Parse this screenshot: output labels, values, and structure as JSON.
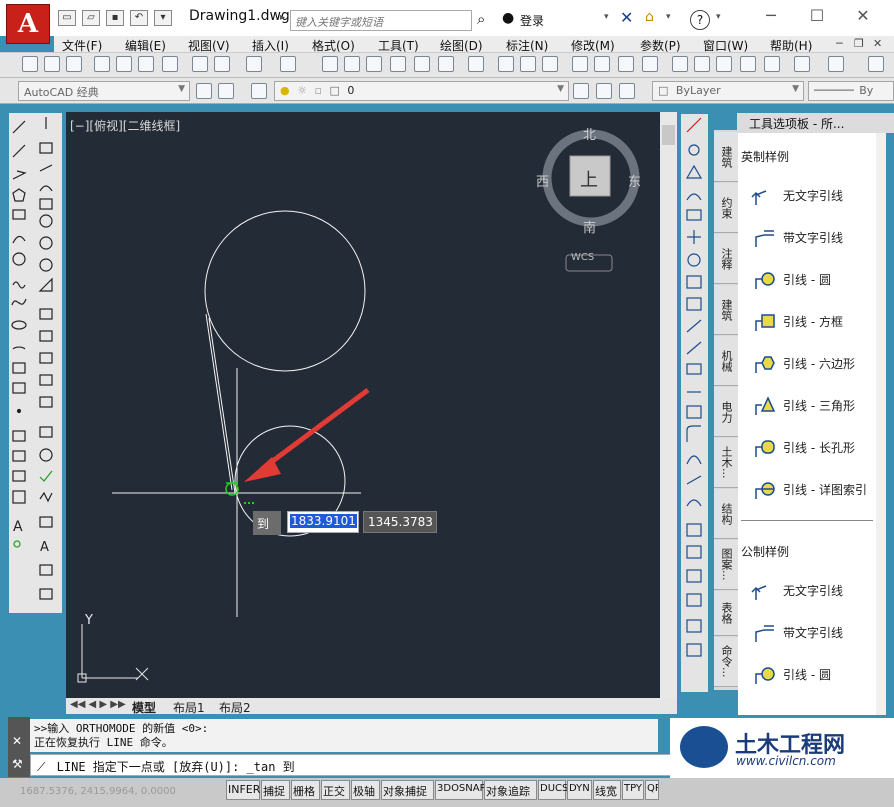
{
  "app": {
    "logo": "A",
    "document_title": "Drawing1.dwg",
    "search_placeholder": "键入关键字或短语",
    "login": "登录"
  },
  "menu": [
    "文件(F)",
    "编辑(E)",
    "视图(V)",
    "插入(I)",
    "格式(O)",
    "工具(T)",
    "绘图(D)",
    "标注(N)",
    "修改(M)",
    "参数(P)",
    "窗口(W)",
    "帮助(H)"
  ],
  "toolbar": {
    "workspace": "AutoCAD 经典",
    "layer": "0",
    "linetype": "ByLayer",
    "linetype_tail": "By"
  },
  "viewport": {
    "label": "[−][俯视][二维线框]",
    "viewcube": {
      "north": "北",
      "south": "南",
      "east": "东",
      "west": "西",
      "top": "上",
      "wcs": "WCS"
    },
    "ucs_y": "Y",
    "ucs_x": "X",
    "dynamic_input": {
      "label": "到",
      "x_value": "1833.9101",
      "y_value": "1345.3783"
    }
  },
  "layout_tabs": [
    "模型",
    "布局1",
    "布局2"
  ],
  "palette": {
    "title": "工具选项板 - 所...",
    "side_tabs": [
      "建筑",
      "约束",
      "注释",
      "建筑",
      "机械",
      "电力",
      "土木...",
      "结构",
      "图案...",
      "表格",
      "命令..."
    ],
    "section_imperial": "英制样例",
    "imperial_items": [
      "无文字引线",
      "带文字引线",
      "引线 - 圆",
      "引线 - 方框",
      "引线 - 六边形",
      "引线 - 三角形",
      "引线 - 长孔形",
      "引线 - 详图索引"
    ],
    "section_metric": "公制样例",
    "metric_items": [
      "无文字引线",
      "带文字引线",
      "引线 - 圆"
    ]
  },
  "command": {
    "history": [
      ">>输入 ORTHOMODE 的新值 <0>:",
      "正在恢复执行 LINE 命令。"
    ],
    "prompt": "LINE 指定下一点或 [放弃(U)]: _tan 到"
  },
  "status": {
    "coords": "1687.5376, 2415.9964, 0.0000",
    "buttons": [
      "INFER",
      "捕捉",
      "栅格",
      "正交",
      "极轴",
      "对象捕捉",
      "3DOSNAP",
      "对象追踪",
      "DUCS",
      "DYN",
      "线宽",
      "TPY",
      "QP"
    ]
  },
  "watermark": {
    "name": "土木工程网",
    "url": "www.civilcn.com"
  },
  "colors": {
    "canvas": "#232b36",
    "accent_red": "#e23a35",
    "snap_green": "#1fd11f",
    "selection_blue": "#1f5bd8"
  }
}
